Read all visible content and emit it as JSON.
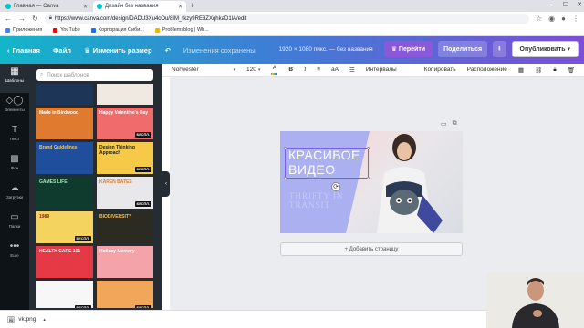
{
  "browser": {
    "tabs": [
      {
        "title": "Главная — Canva"
      },
      {
        "title": "Дизайн без названия"
      }
    ],
    "new_tab": "+",
    "url": "https://www.canva.com/design/DADU3Xu4cOu/8IM_rkzy9RE3ZXqhkaD1lA/edit",
    "bookmarks": [
      {
        "label": "Приложения",
        "color": "#4285f4"
      },
      {
        "label": "YouTube",
        "color": "#ff0000"
      },
      {
        "label": "Корпорация Сиби...",
        "color": "#1a73e8"
      },
      {
        "label": "Problemsblog | Wh...",
        "color": "#f4b400"
      }
    ]
  },
  "header": {
    "home_label": "Главная",
    "file_label": "Файл",
    "resize_label": "Изменить размер",
    "undo_icon": "undo-icon",
    "saved_status": "Изменения сохранены",
    "size_info": "1920 × 1080 пикс. — без названия",
    "goto_label": "Перейти",
    "share_label": "Поделиться",
    "publish_label": "Опубликовать"
  },
  "rail": [
    {
      "label": "Шаблоны",
      "icon": "▦",
      "active": true
    },
    {
      "label": "Элементы",
      "icon": "◇◯",
      "active": false
    },
    {
      "label": "Текст",
      "icon": "T",
      "active": false
    },
    {
      "label": "Фон",
      "icon": "▩",
      "active": false
    },
    {
      "label": "Загрузки",
      "icon": "☁",
      "active": false
    },
    {
      "label": "Папки",
      "icon": "▭",
      "active": false
    },
    {
      "label": "Еще",
      "icon": "•••",
      "active": false
    }
  ],
  "panel": {
    "search_placeholder": "Поиск шаблонов",
    "templates": [
      {
        "title": "",
        "bg": "#1d3557",
        "fg": "#fff",
        "badge": ""
      },
      {
        "title": "Writing Kit",
        "bg": "#f0e9e2",
        "fg": "#333",
        "badge": ""
      },
      {
        "title": "Made in Birdwood",
        "bg": "#e07a2f",
        "fg": "#fff",
        "badge": ""
      },
      {
        "title": "Happy Valentine's Day",
        "bg": "#f06b6b",
        "fg": "#fff",
        "badge": "БЕСПЛ."
      },
      {
        "title": "Brand Guidelines",
        "bg": "#1f4e9c",
        "fg": "#f7c948",
        "badge": ""
      },
      {
        "title": "Design Thinking Approach",
        "bg": "#f7c948",
        "fg": "#222",
        "badge": "БЕСПЛ."
      },
      {
        "title": "GAMES LIFE",
        "bg": "#0f3b2e",
        "fg": "#9fe3b0",
        "badge": ""
      },
      {
        "title": "KAREN BATES",
        "bg": "#e8e8ea",
        "fg": "#e07a2f",
        "badge": "БЕСПЛ."
      },
      {
        "title": "1989",
        "bg": "#f4d35e",
        "fg": "#8a2b12",
        "badge": "БЕСПЛ."
      },
      {
        "title": "BIODIVERSITY",
        "bg": "#2b2b22",
        "fg": "#f2c14e",
        "badge": ""
      },
      {
        "title": "HEALTH CARE 101",
        "bg": "#e63946",
        "fg": "#fff",
        "badge": ""
      },
      {
        "title": "Holiday Memory",
        "bg": "#f4a3a8",
        "fg": "#fff",
        "badge": ""
      },
      {
        "title": "",
        "bg": "#f7f7f7",
        "fg": "#333",
        "badge": "БЕСПЛ."
      },
      {
        "title": "",
        "bg": "#f2a65a",
        "fg": "#fff",
        "badge": "БЕСПЛ."
      }
    ]
  },
  "toolbar": {
    "font": "Norwester",
    "size": "120",
    "bold": "B",
    "italic": "I",
    "spacing_label": "Интервалы",
    "copy_style_label": "Копировать",
    "arrange_label": "Расположение"
  },
  "design": {
    "title_line1": "КРАСИВОЕ",
    "title_line2": "ВИДЕО",
    "subtitle_line1": "THRIFTY IN",
    "subtitle_line2": "TRANSIT",
    "accent": "#aab0f0"
  },
  "canvas": {
    "add_page_label": "+ Добавить страницу"
  },
  "downloads": {
    "file": "vk.png"
  },
  "colors": {
    "header_start": "#13b6c9",
    "header_end": "#7b4fd6",
    "panel_bg": "#252c34",
    "rail_bg": "#0e1318"
  }
}
